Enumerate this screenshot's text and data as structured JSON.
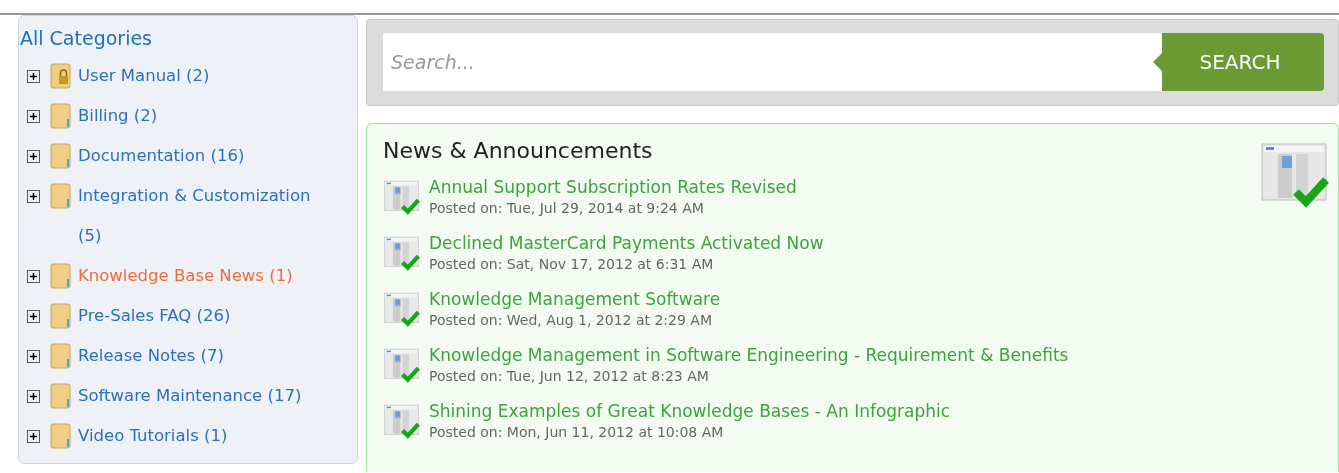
{
  "sidebar": {
    "title": "All Categories",
    "items": [
      {
        "label": "User Manual (2)",
        "locked": true,
        "selected": false
      },
      {
        "label": "Billing (2)",
        "locked": false,
        "selected": false
      },
      {
        "label": "Documentation (16)",
        "locked": false,
        "selected": false
      },
      {
        "label": "Integration & Customization (5)",
        "locked": false,
        "selected": false
      },
      {
        "label": "Knowledge Base News (1)",
        "locked": false,
        "selected": true
      },
      {
        "label": "Pre-Sales FAQ (26)",
        "locked": false,
        "selected": false
      },
      {
        "label": "Release Notes (7)",
        "locked": false,
        "selected": false
      },
      {
        "label": "Software Maintenance (17)",
        "locked": false,
        "selected": false
      },
      {
        "label": "Video Tutorials (1)",
        "locked": false,
        "selected": false
      }
    ]
  },
  "search": {
    "placeholder": "Search...",
    "button": "SEARCH"
  },
  "news": {
    "title": "News & Announcements",
    "items": [
      {
        "title": "Annual Support Subscription Rates Revised",
        "posted": "Posted on: Tue, Jul 29, 2014 at 9:24 AM"
      },
      {
        "title": "Declined MasterCard Payments Activated Now",
        "posted": "Posted on: Sat, Nov 17, 2012 at 6:31 AM"
      },
      {
        "title": "Knowledge Management Software",
        "posted": "Posted on: Wed, Aug 1, 2012 at 2:29 AM"
      },
      {
        "title": "Knowledge Management in Software Engineering - Requirement & Benefits",
        "posted": "Posted on: Tue, Jun 12, 2012 at 8:23 AM"
      },
      {
        "title": "Shining Examples of Great Knowledge Bases - An Infographic",
        "posted": "Posted on: Mon, Jun 11, 2012 at 10:08 AM"
      }
    ]
  }
}
